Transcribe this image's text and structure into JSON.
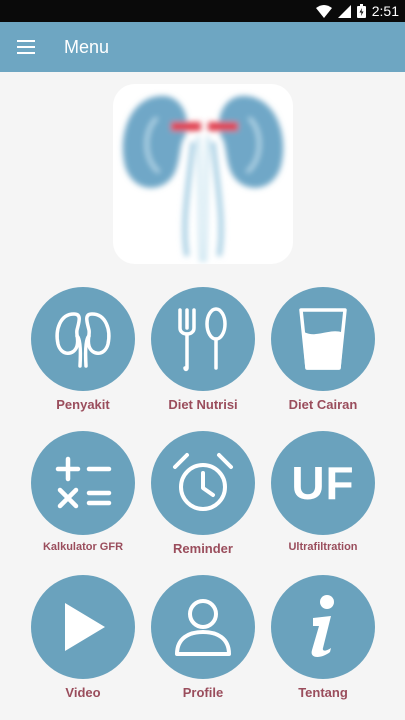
{
  "status_bar": {
    "time": "2:51"
  },
  "app_bar": {
    "title": "Menu"
  },
  "menu": [
    {
      "label": "Penyakit",
      "icon": "kidney-icon"
    },
    {
      "label": "Diet Nutrisi",
      "icon": "fork-spoon-icon"
    },
    {
      "label": "Diet Cairan",
      "icon": "glass-water-icon"
    },
    {
      "label": "Kalkulator GFR",
      "icon": "calculator-icon"
    },
    {
      "label": "Reminder",
      "icon": "alarm-clock-icon"
    },
    {
      "label": "Ultrafiltration",
      "icon": "uf-icon",
      "icon_text": "UF"
    },
    {
      "label": "Video",
      "icon": "play-icon"
    },
    {
      "label": "Profile",
      "icon": "profile-icon"
    },
    {
      "label": "Tentang",
      "icon": "info-icon"
    }
  ],
  "colors": {
    "app_bar": "#6ea6c2",
    "tile": "#6aa2bd",
    "label": "#9a4d5c"
  }
}
